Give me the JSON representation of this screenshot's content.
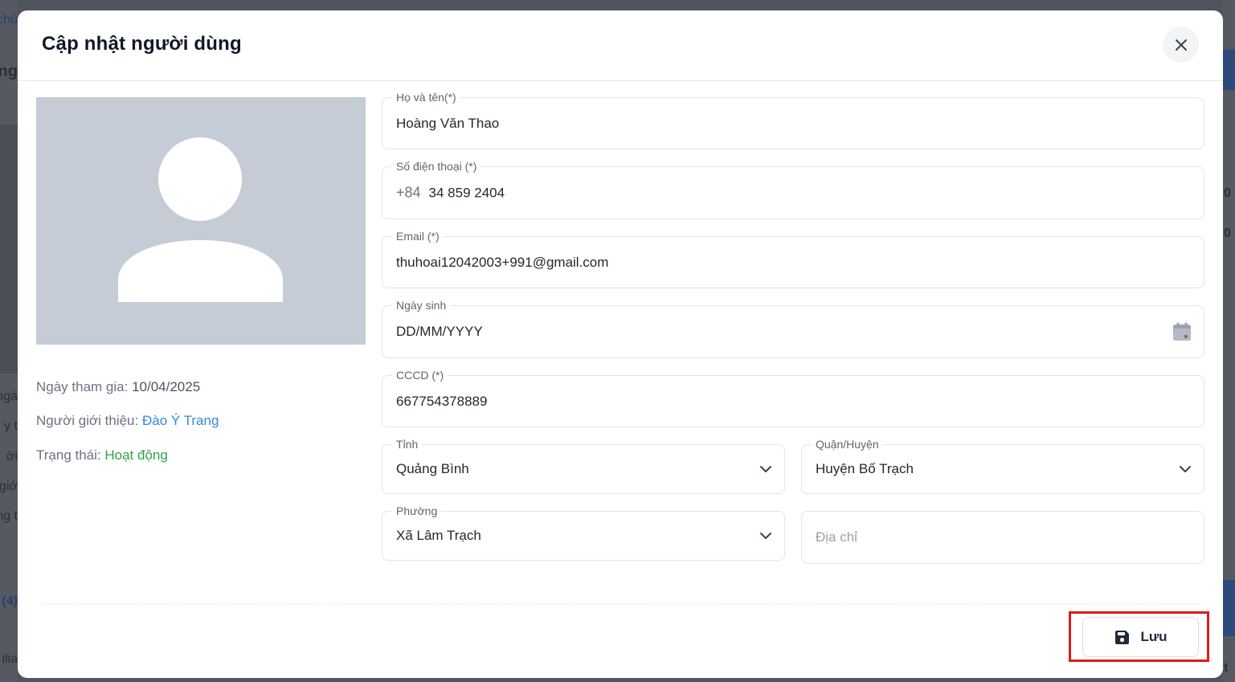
{
  "modal": {
    "title": "Cập nhật người dùng"
  },
  "profile": {
    "join_label": "Ngày tham gia:",
    "join_value": "10/04/2025",
    "referrer_label": "Người giới thiệu:",
    "referrer_value": "Đào Ý Trang",
    "status_label": "Trạng thái:",
    "status_value": "Hoạt động"
  },
  "form": {
    "fullname": {
      "label": "Họ và tên(*)",
      "value": "Hoàng Văn Thao"
    },
    "phone": {
      "label": "Số điện thoại (*)",
      "prefix": "+84",
      "value": "34 859 2404"
    },
    "email": {
      "label": "Email (*)",
      "value": "thuhoai12042003+991@gmail.com"
    },
    "birthday": {
      "label": "Ngày sinh",
      "value": "DD/MM/YYYY"
    },
    "cccd": {
      "label": "CCCD (*)",
      "value": "667754378889"
    },
    "province": {
      "label": "Tỉnh",
      "value": "Quảng Bình"
    },
    "district": {
      "label": "Quận/Huyện",
      "value": "Huyện Bố Trạch"
    },
    "ward": {
      "label": "Phường",
      "value": "Xã Lâm Trạch"
    },
    "address": {
      "placeholder": "Địa chỉ"
    }
  },
  "actions": {
    "save_label": "Lưu"
  },
  "colors": {
    "link": "#2f8ae0",
    "status_active": "#2fa24a",
    "highlight": "#e01b1b",
    "avatar_bg": "#c5ccd6"
  },
  "background": {
    "left_fragments": [
      "chủ",
      "ong",
      "ngà",
      "y t",
      "ời",
      "giớ",
      "ng t",
      "(4)",
      "ilia"
    ],
    "right_fragments": [
      "0",
      "0 c",
      "t"
    ]
  }
}
